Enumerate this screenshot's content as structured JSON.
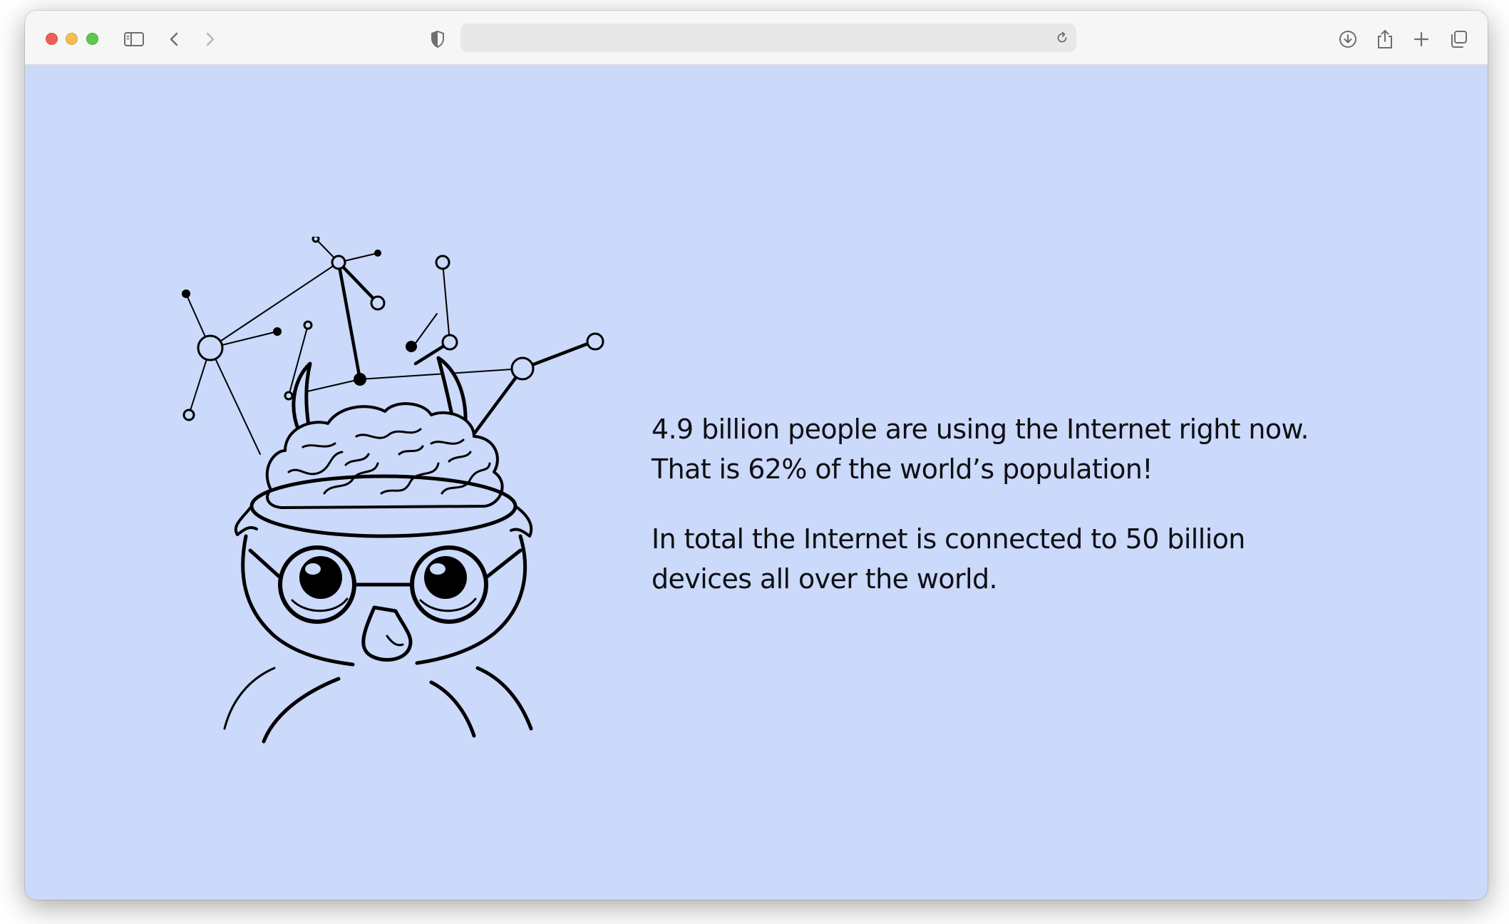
{
  "browser": {
    "address_placeholder": "",
    "address_value": ""
  },
  "colors": {
    "page_background": "#cbd9fa",
    "text": "#0f0f14",
    "illustration_stroke": "#000000"
  },
  "illustration": {
    "icon": "brain-network-owl-illustration"
  },
  "content": {
    "paragraph_1_line_1": "4.9 billion people are using the Internet right now.",
    "paragraph_1_line_2": "That is 62% of the world’s population!",
    "paragraph_2_line_1": "In total the Internet is connected to 50 billion",
    "paragraph_2_line_2": "devices all over the world."
  }
}
